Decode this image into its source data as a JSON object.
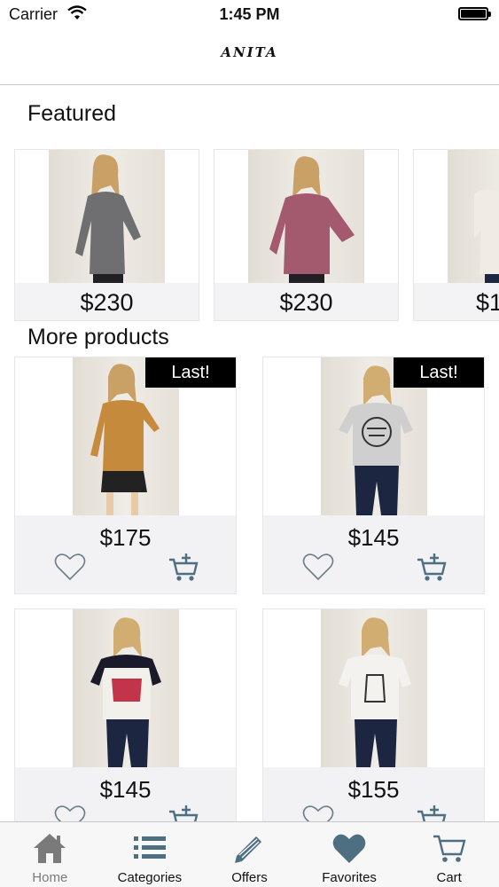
{
  "status_bar": {
    "carrier": "Carrier",
    "time": "1:45 PM"
  },
  "header": {
    "logo": "ANITA"
  },
  "sections": {
    "featured_title": "Featured",
    "more_title": "More products"
  },
  "featured": [
    {
      "price": "$230",
      "shirt_color": "#6f6f72"
    },
    {
      "price": "$230",
      "shirt_color": "#a35a6e"
    },
    {
      "price": "$1",
      "shirt_color": "#f0ece4"
    }
  ],
  "products": [
    {
      "price": "$175",
      "badge": "Last!",
      "shirt_color": "#c68a3c",
      "bottom_color": "#222"
    },
    {
      "price": "$145",
      "badge": "Last!",
      "shirt_color": "#cfcfcf",
      "bottom_color": "#1c2640"
    },
    {
      "price": "$145",
      "badge": "",
      "shirt_color": "#f2f0ea",
      "bottom_color": "#1c2640"
    },
    {
      "price": "$155",
      "badge": "",
      "shirt_color": "#f4f2ee",
      "bottom_color": "#1c2640"
    }
  ],
  "tabs": [
    {
      "label": "Home",
      "icon": "home-icon"
    },
    {
      "label": "Categories",
      "icon": "list-icon"
    },
    {
      "label": "Offers",
      "icon": "pencil-tag-icon"
    },
    {
      "label": "Favorites",
      "icon": "heart-icon"
    },
    {
      "label": "Cart",
      "icon": "cart-icon"
    }
  ],
  "colors": {
    "accent": "#4e6e82",
    "tab_inactive": "#7a7a7a",
    "price_band": "#f2f2f4"
  }
}
